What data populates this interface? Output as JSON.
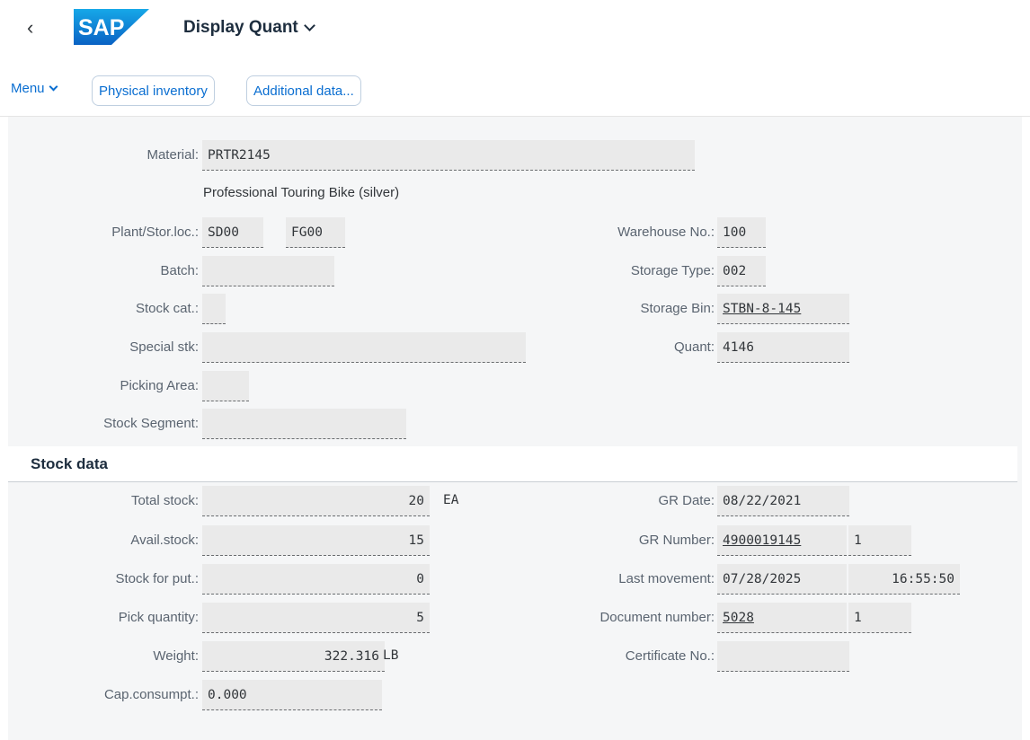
{
  "header": {
    "back_icon": "chevron-left-icon",
    "logo_text": "SAP",
    "title": "Display Quant"
  },
  "toolbar": {
    "menu_label": "Menu",
    "buttons": [
      "Physical inventory",
      "Additional data..."
    ]
  },
  "header_fields": {
    "material": {
      "label": "Material:",
      "value": "PRTR2145"
    },
    "material_desc": "Professional Touring Bike (silver)",
    "plant_stor": {
      "label": "Plant/Stor.loc.:",
      "plant": "SD00",
      "stor": "FG00"
    },
    "batch": {
      "label": "Batch:",
      "value": ""
    },
    "stock_cat": {
      "label": "Stock cat.:",
      "value": ""
    },
    "special_stk": {
      "label": "Special stk:",
      "value": ""
    },
    "picking_area": {
      "label": "Picking Area:",
      "value": ""
    },
    "stock_segment": {
      "label": "Stock Segment:",
      "value": ""
    },
    "warehouse_no": {
      "label": "Warehouse No.:",
      "value": "100"
    },
    "storage_type": {
      "label": "Storage Type:",
      "value": "002"
    },
    "storage_bin": {
      "label": "Storage Bin:",
      "value": "STBN-8-145"
    },
    "quant": {
      "label": "Quant:",
      "value": "4146"
    }
  },
  "stock_data": {
    "section_title": "Stock data",
    "total_stock": {
      "label": "Total stock:",
      "value": "20",
      "unit": "EA"
    },
    "avail_stock": {
      "label": "Avail.stock:",
      "value": "15"
    },
    "stock_for_put": {
      "label": "Stock for put.:",
      "value": "0"
    },
    "pick_quantity": {
      "label": "Pick quantity:",
      "value": "5"
    },
    "weight": {
      "label": "Weight:",
      "value": "322.316",
      "unit": "LB"
    },
    "cap_consumpt": {
      "label": "Cap.consumpt.:",
      "value": "0.000"
    },
    "gr_date": {
      "label": "GR Date:",
      "value": "08/22/2021"
    },
    "gr_number": {
      "label": "GR Number:",
      "value": "4900019145",
      "item": "1"
    },
    "last_movement": {
      "label": "Last movement:",
      "date": "07/28/2025",
      "time": "16:55:50"
    },
    "document_number": {
      "label": "Document number:",
      "value": "5028",
      "item": "1"
    },
    "certificate_no": {
      "label": "Certificate No.:",
      "value": ""
    }
  },
  "colors": {
    "brand": "#0a6ed1",
    "logo_blue": "#0f7ed8",
    "field_bg": "#eaeaea",
    "content_bg": "#f5f6f7"
  }
}
